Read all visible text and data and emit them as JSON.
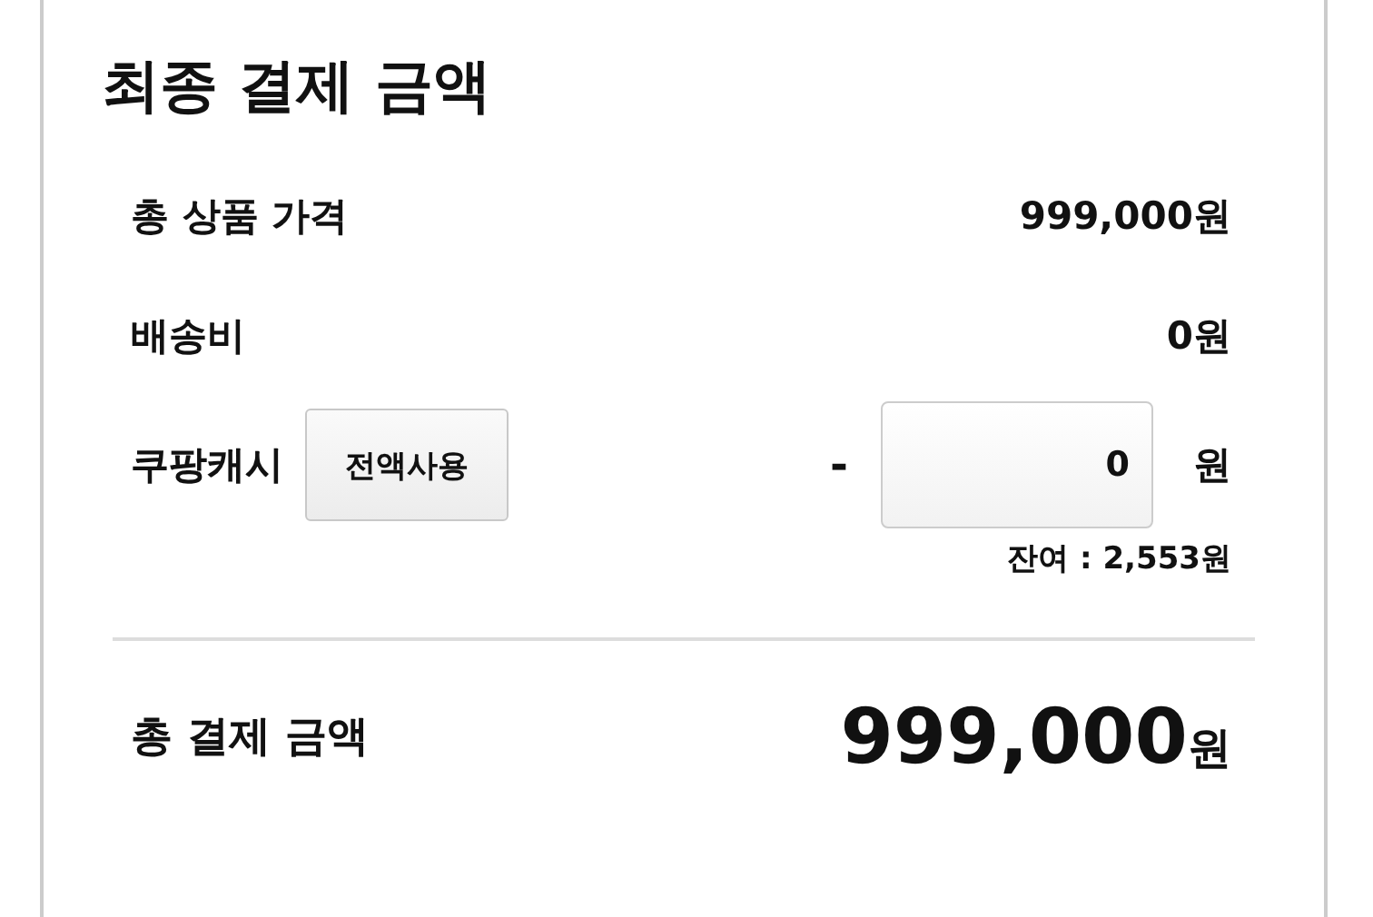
{
  "title": "최종 결제 금액",
  "rows": [
    {
      "kind": "amount",
      "label": "총 상품 가격",
      "value": "999,000원"
    },
    {
      "kind": "amount",
      "label": "배송비",
      "value": "0원"
    },
    {
      "kind": "cash",
      "label": "쿠팡캐시",
      "button": "전액사용",
      "sign": "-",
      "input_value": "0",
      "unit": "원",
      "balance": "잔여 : 2,553원"
    }
  ],
  "total": {
    "label": "총 결제 금액",
    "value": "999,000",
    "unit": "원"
  }
}
